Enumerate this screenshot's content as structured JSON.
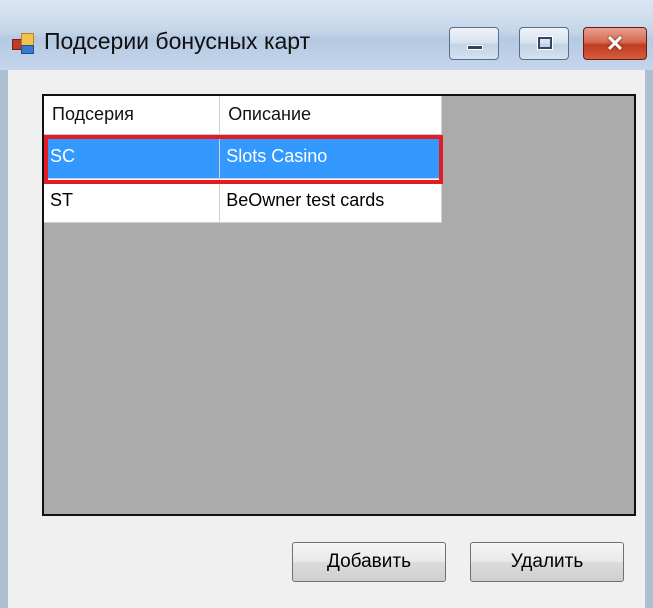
{
  "window": {
    "title": "Подсерии бонусных карт",
    "controls": {
      "minimize": "minimize",
      "maximize": "maximize",
      "close": "x"
    }
  },
  "grid": {
    "columns": [
      "Подсерия",
      "Описание"
    ],
    "rows": [
      {
        "code": "SC",
        "description": "Slots Casino",
        "selected": true
      },
      {
        "code": "ST",
        "description": "BeOwner test cards",
        "selected": false
      }
    ],
    "selection_color": "#3399ff",
    "highlight_color": "#e21b25"
  },
  "buttons": {
    "add_label": "Добавить",
    "delete_label": "Удалить"
  },
  "icons": {
    "window_icon": "app-window-icon",
    "close": "close-icon"
  }
}
